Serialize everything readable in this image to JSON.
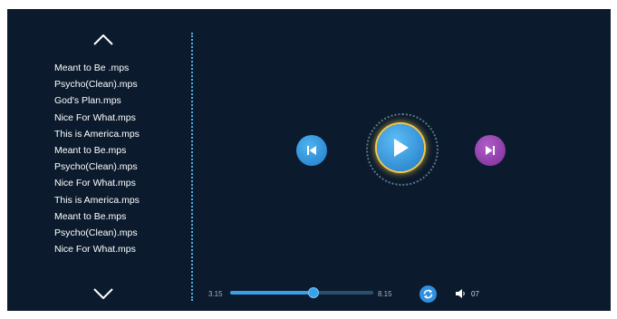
{
  "playlist": {
    "scroll_up_icon": "chevron-up-icon",
    "scroll_down_icon": "chevron-down-icon",
    "items": [
      "Meant to Be .mps",
      "Psycho(Clean).mps",
      "God's Plan.mps",
      "Nice For What.mps",
      "This is America.mps",
      "Meant to Be.mps",
      "Psycho(Clean).mps",
      "Nice For What.mps",
      "This is America.mps",
      "Meant to Be.mps",
      "Psycho(Clean).mps",
      "Nice For What.mps"
    ]
  },
  "controls": {
    "previous_icon": "skip-previous-icon",
    "play_icon": "play-icon",
    "next_icon": "skip-next-icon",
    "previous_color": "#2f8fe0",
    "next_color": "#8e3aae",
    "play_glow_color": "#f2c94c"
  },
  "progress": {
    "current_time": "3.15",
    "total_time": "8.15",
    "fraction": 0.58
  },
  "repeat_icon": "repeat-icon",
  "volume": {
    "icon": "speaker-icon",
    "value": "07"
  },
  "colors": {
    "background": "#0b1b2d",
    "accent": "#3aa0e8",
    "text": "#ffffff"
  }
}
